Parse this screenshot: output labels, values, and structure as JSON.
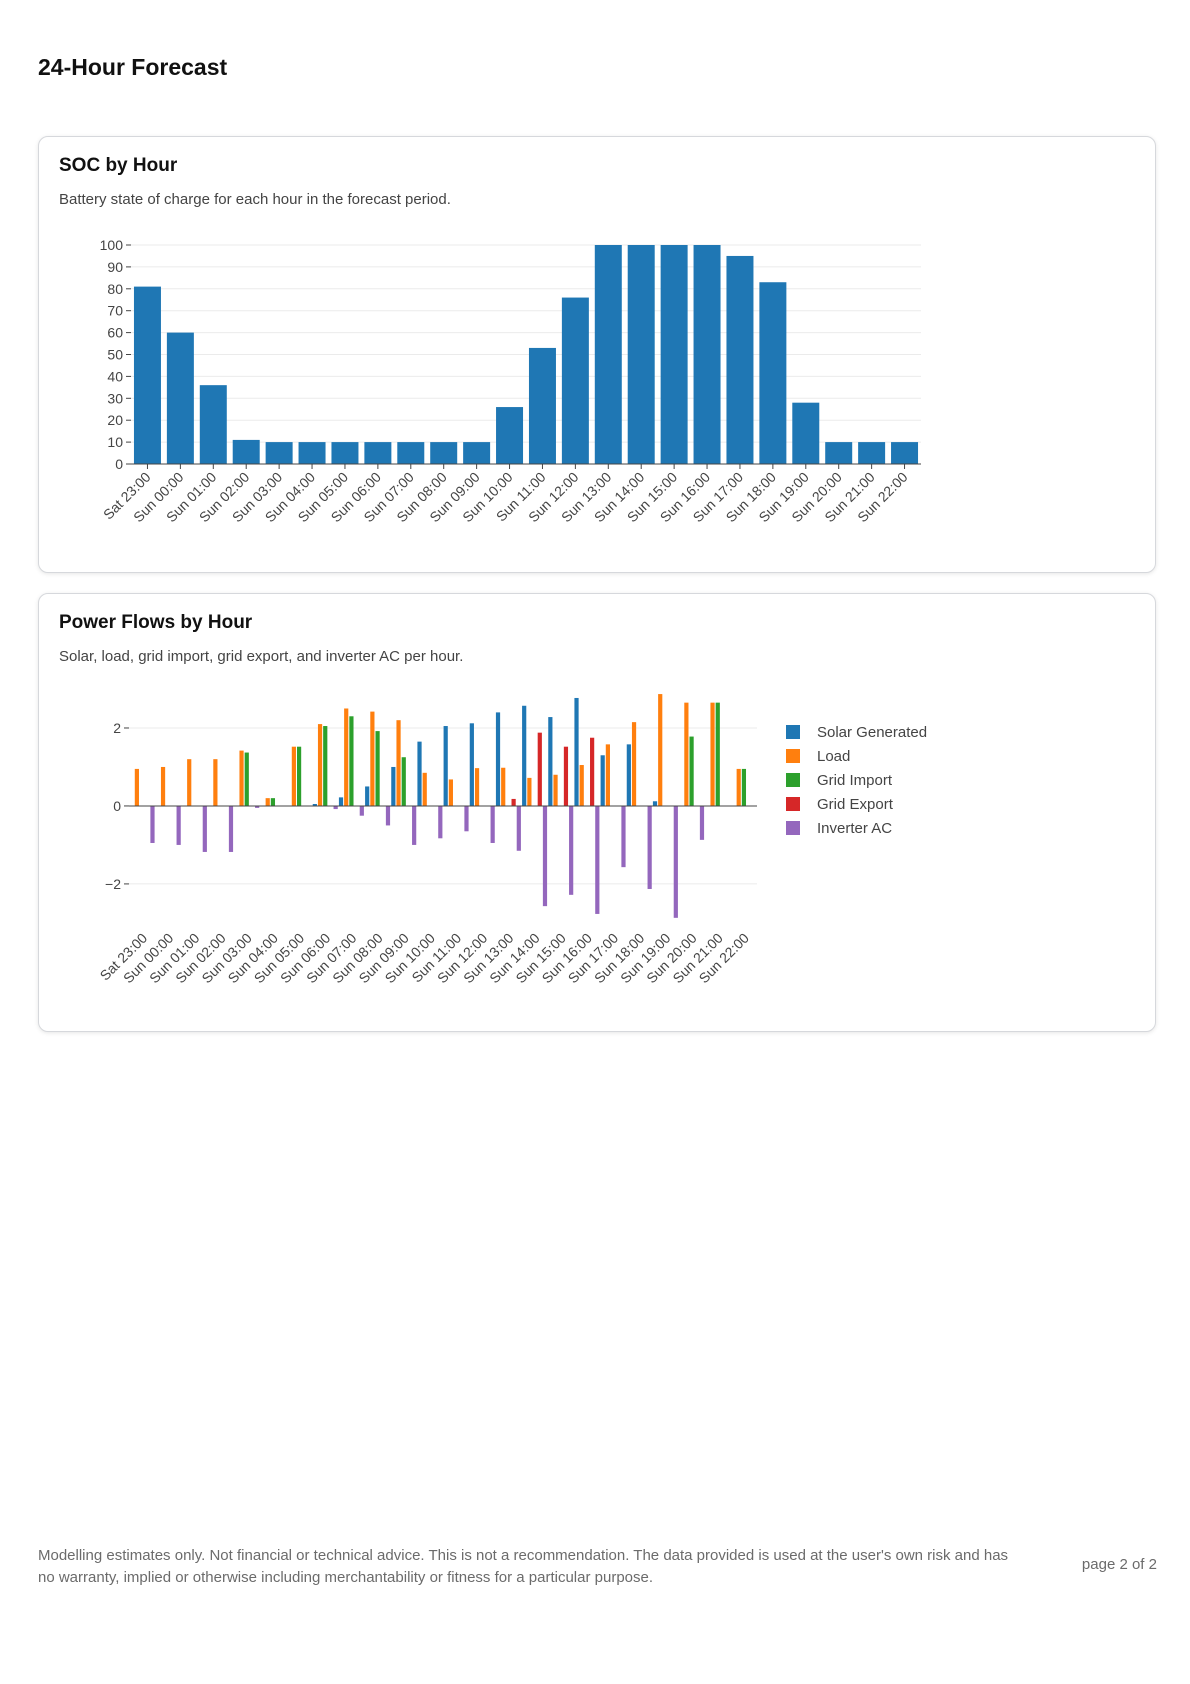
{
  "page": {
    "title": "24-Hour Forecast"
  },
  "soc_card": {
    "title": "SOC by Hour",
    "description": "Battery state of charge for each hour in the forecast period."
  },
  "power_card": {
    "title": "Power Flows by Hour",
    "description": "Solar, load, grid import, grid export, and inverter AC per hour."
  },
  "footer": {
    "disclaimer": "Modelling estimates only. Not financial or technical advice. This is not a recommendation. The data provided is used at the user's own risk and has no warranty, implied or otherwise including merchantability or fitness for a particular purpose.",
    "page_number": "page 2 of 2"
  },
  "chart_data": [
    {
      "type": "bar",
      "categories": [
        "Sat 23:00",
        "Sun 00:00",
        "Sun 01:00",
        "Sun 02:00",
        "Sun 03:00",
        "Sun 04:00",
        "Sun 05:00",
        "Sun 06:00",
        "Sun 07:00",
        "Sun 08:00",
        "Sun 09:00",
        "Sun 10:00",
        "Sun 11:00",
        "Sun 12:00",
        "Sun 13:00",
        "Sun 14:00",
        "Sun 15:00",
        "Sun 16:00",
        "Sun 17:00",
        "Sun 18:00",
        "Sun 19:00",
        "Sun 20:00",
        "Sun 21:00",
        "Sun 22:00"
      ],
      "values": [
        81,
        60,
        36,
        11,
        10,
        10,
        10,
        10,
        10,
        10,
        10,
        26,
        53,
        76,
        100,
        100,
        100,
        100,
        95,
        83,
        28,
        10,
        10,
        10
      ],
      "ylim": [
        0,
        100
      ],
      "yticks": [
        0,
        10,
        20,
        30,
        40,
        50,
        60,
        70,
        80,
        90,
        100
      ],
      "grid": true,
      "color": "#1f77b4"
    },
    {
      "type": "bar",
      "categories": [
        "Sat 23:00",
        "Sun 00:00",
        "Sun 01:00",
        "Sun 02:00",
        "Sun 03:00",
        "Sun 04:00",
        "Sun 05:00",
        "Sun 06:00",
        "Sun 07:00",
        "Sun 08:00",
        "Sun 09:00",
        "Sun 10:00",
        "Sun 11:00",
        "Sun 12:00",
        "Sun 13:00",
        "Sun 14:00",
        "Sun 15:00",
        "Sun 16:00",
        "Sun 17:00",
        "Sun 18:00",
        "Sun 19:00",
        "Sun 20:00",
        "Sun 21:00",
        "Sun 22:00"
      ],
      "series": [
        {
          "name": "Solar Generated",
          "color": "#1f77b4",
          "values": [
            0,
            0,
            0,
            0,
            0,
            0,
            0,
            0.05,
            0.22,
            0.5,
            1.0,
            1.65,
            2.05,
            2.12,
            2.4,
            2.57,
            2.28,
            2.77,
            1.3,
            1.58,
            0.12,
            0,
            0,
            0
          ]
        },
        {
          "name": "Load",
          "color": "#ff7f0e",
          "values": [
            0.95,
            1.0,
            1.2,
            1.2,
            1.42,
            0.2,
            1.52,
            2.1,
            2.5,
            2.42,
            2.2,
            0.85,
            0.68,
            0.97,
            0.98,
            0.72,
            0.8,
            1.05,
            1.58,
            2.15,
            2.87,
            2.65,
            2.65,
            0.95
          ]
        },
        {
          "name": "Grid Import",
          "color": "#2ca02c",
          "values": [
            0,
            0,
            0,
            0,
            1.37,
            0.2,
            1.52,
            2.05,
            2.3,
            1.92,
            1.25,
            0,
            0,
            0,
            0,
            0,
            0,
            0,
            0,
            0,
            0,
            1.78,
            2.65,
            0.95
          ]
        },
        {
          "name": "Grid Export",
          "color": "#d62728",
          "values": [
            0,
            0,
            0,
            0,
            0,
            0,
            0,
            0,
            0,
            0,
            0,
            0,
            0,
            0,
            0.18,
            1.88,
            1.52,
            1.75,
            0,
            0,
            0,
            0,
            0,
            0
          ]
        },
        {
          "name": "Inverter AC",
          "color": "#9467bd",
          "values": [
            -0.95,
            -1.0,
            -1.18,
            -1.18,
            -0.05,
            0,
            0,
            -0.08,
            -0.25,
            -0.5,
            -1.0,
            -0.83,
            -0.65,
            -0.95,
            -1.15,
            -2.57,
            -2.28,
            -2.77,
            -1.57,
            -2.13,
            -2.87,
            -0.87,
            0,
            0
          ]
        }
      ],
      "ylim": [
        -2.9,
        3.0
      ],
      "yticks": [
        -2,
        0,
        2
      ],
      "ytick_labels": [
        "−2",
        "0",
        "2"
      ],
      "grid": true,
      "legend": "right"
    }
  ]
}
